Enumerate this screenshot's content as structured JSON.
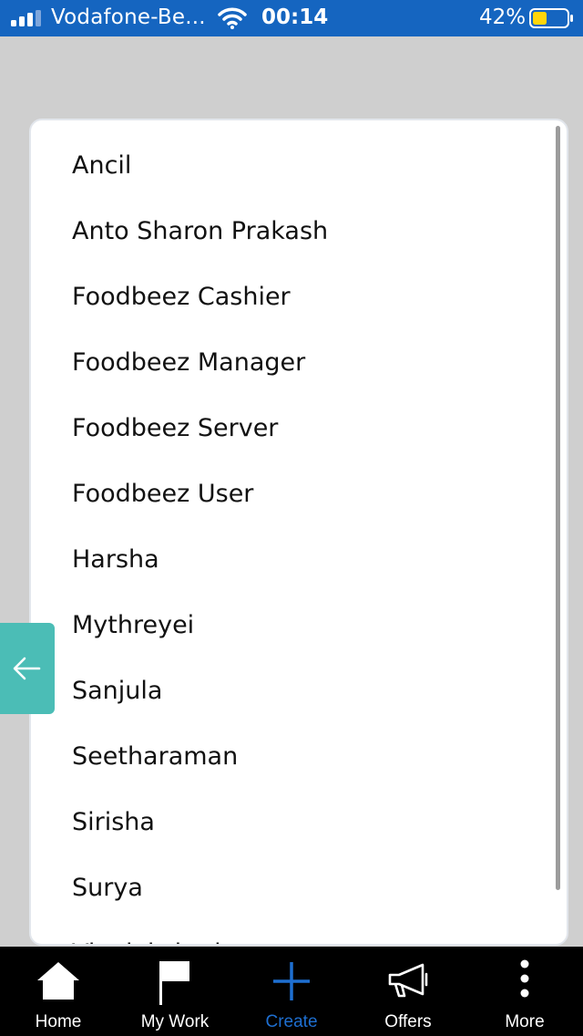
{
  "status_bar": {
    "carrier": "Vodafone-Be...",
    "time": "00:14",
    "battery_percent": "42%",
    "battery_level": 0.42,
    "battery_color": "#ffd60a"
  },
  "list": {
    "items": [
      {
        "label": "Ancil"
      },
      {
        "label": "Anto Sharon Prakash"
      },
      {
        "label": "Foodbeez Cashier"
      },
      {
        "label": "Foodbeez Manager"
      },
      {
        "label": "Foodbeez Server"
      },
      {
        "label": "Foodbeez User"
      },
      {
        "label": "Harsha"
      },
      {
        "label": "Mythreyei"
      },
      {
        "label": "Sanjula"
      },
      {
        "label": "Seetharaman"
      },
      {
        "label": "Sirisha"
      },
      {
        "label": "Surya"
      },
      {
        "label": "Vinolakshmi"
      }
    ]
  },
  "back_tab": {
    "icon": "arrow-left-icon",
    "color": "#4bbdb6"
  },
  "bottom_nav": {
    "items": [
      {
        "label": "Home",
        "icon": "home-icon"
      },
      {
        "label": "My Work",
        "icon": "flag-icon"
      },
      {
        "label": "Create",
        "icon": "plus-icon"
      },
      {
        "label": "Offers",
        "icon": "megaphone-icon"
      },
      {
        "label": "More",
        "icon": "more-vertical-icon"
      }
    ],
    "active": "Create",
    "active_color": "#1e6fd1"
  },
  "colors": {
    "status_bar": "#1565c0",
    "backdrop": "#cfcfcf"
  }
}
